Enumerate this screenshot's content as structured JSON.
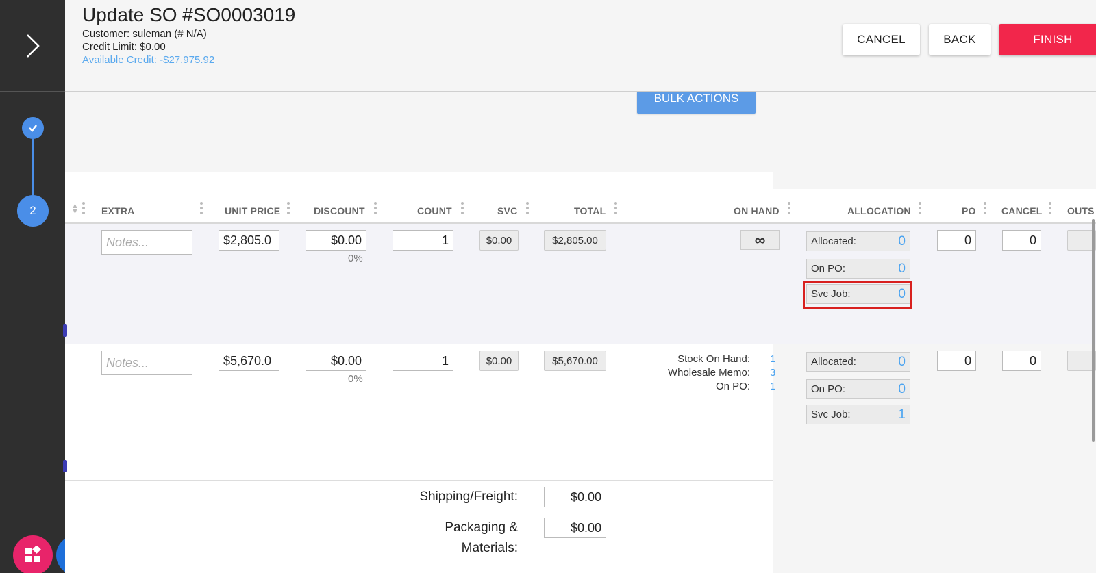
{
  "header": {
    "title": "Update SO #SO0003019",
    "customer": "Customer: suleman (# N/A)",
    "credit_limit": "Credit Limit: $0.00",
    "available_credit": "Available Credit: -$27,975.92",
    "cancel_label": "CANCEL",
    "back_label": "BACK",
    "finish_label": "FINISH"
  },
  "steps": {
    "step2_label": "2"
  },
  "bulk_actions_label": "BULK ACTIONS",
  "columns": {
    "extra": "EXTRA",
    "unit_price": "UNIT PRICE",
    "discount": "DISCOUNT",
    "count": "COUNT",
    "svc": "SVC",
    "total": "TOTAL",
    "on_hand": "ON HAND",
    "allocation": "ALLOCATION",
    "po": "PO",
    "cancel": "CANCEL",
    "outstanding": "OUTS"
  },
  "rows": [
    {
      "notes_placeholder": "Notes...",
      "unit_price": "$2,805.0",
      "discount": "$0.00",
      "discount_pct": "0%",
      "count": "1",
      "svc": "$0.00",
      "total": "$2,805.00",
      "on_hand": "∞",
      "allocated_label": "Allocated:",
      "allocated_value": "0",
      "on_po_label": "On PO:",
      "on_po_value": "0",
      "svc_job_label": "Svc Job:",
      "svc_job_value": "0",
      "po": "0",
      "cancel": "0"
    },
    {
      "notes_placeholder": "Notes...",
      "unit_price": "$5,670.0",
      "discount": "$0.00",
      "discount_pct": "0%",
      "count": "1",
      "svc": "$0.00",
      "total": "$5,670.00",
      "stock_on_hand_label": "Stock On Hand:",
      "stock_on_hand_value": "1",
      "wholesale_memo_label": "Wholesale Memo:",
      "wholesale_memo_value": "3",
      "on_po_stock_label": "On PO:",
      "on_po_stock_value": "1",
      "allocated_label": "Allocated:",
      "allocated_value": "0",
      "on_po_label": "On PO:",
      "on_po_value": "0",
      "svc_job_label": "Svc Job:",
      "svc_job_value": "1",
      "po": "0",
      "cancel": "0"
    }
  ],
  "footer": {
    "shipping_label": "Shipping/Freight:",
    "shipping_value": "$0.00",
    "packaging_label_1": "Packaging &",
    "packaging_label_2": "Materials:",
    "packaging_value": "$0.00"
  },
  "colors": {
    "accent": "#4a8ee8",
    "finish": "#f2264b",
    "highlight": "#d8201f",
    "link_value": "#4aa3f0"
  }
}
